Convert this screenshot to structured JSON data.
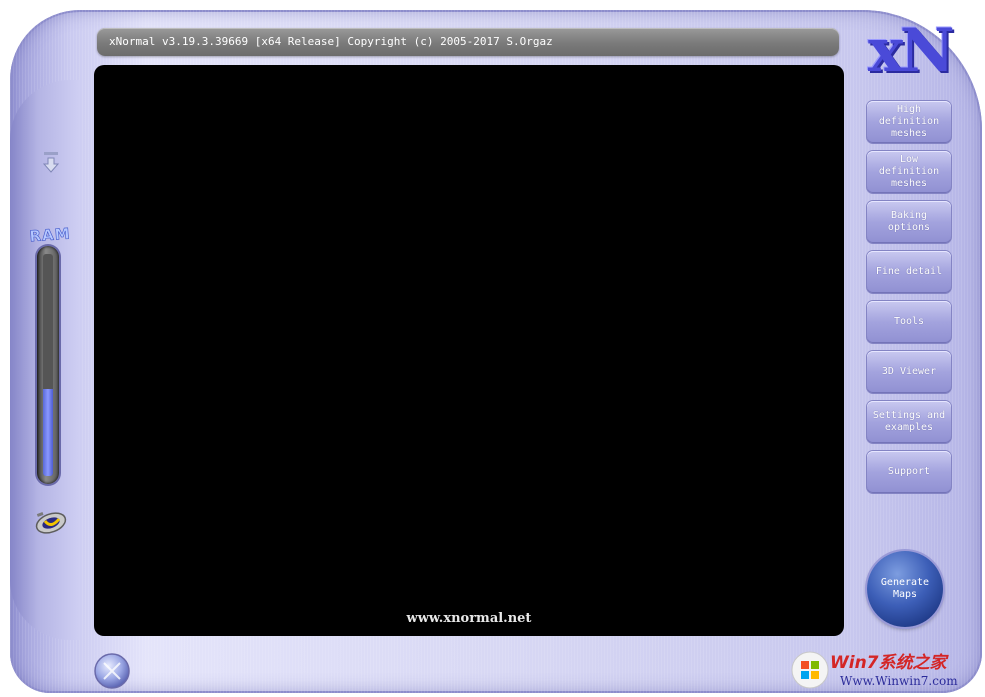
{
  "window": {
    "title": "xNormal v3.19.3.39669 [x64 Release] Copyright (c) 2005-2017 S.Orgaz",
    "logo_text": "xN"
  },
  "viewport": {
    "url_text": "www.xnormal.net"
  },
  "side_menu": {
    "items": [
      {
        "label": "High definition meshes"
      },
      {
        "label": "Low definition meshes"
      },
      {
        "label": "Baking options"
      },
      {
        "label": "Fine detail"
      },
      {
        "label": "Tools"
      },
      {
        "label": "3D Viewer"
      },
      {
        "label": "Settings and examples"
      },
      {
        "label": "Support"
      }
    ],
    "generate_label": "Generate Maps"
  },
  "ram": {
    "label": "RAM",
    "usage_fraction": 0.39
  },
  "icons": {
    "down": "arrow-down-icon",
    "plug": "plug-icon",
    "orb": "orb-icon"
  },
  "watermark": {
    "title": "Win7系统之家",
    "url": "Www.Winwin7.com"
  },
  "colors": {
    "skin": "#d8d8f4",
    "viewport": "#000000",
    "logo": "#4a4ad8",
    "button": "#a3a3de",
    "generate": "#3d5fb8"
  }
}
